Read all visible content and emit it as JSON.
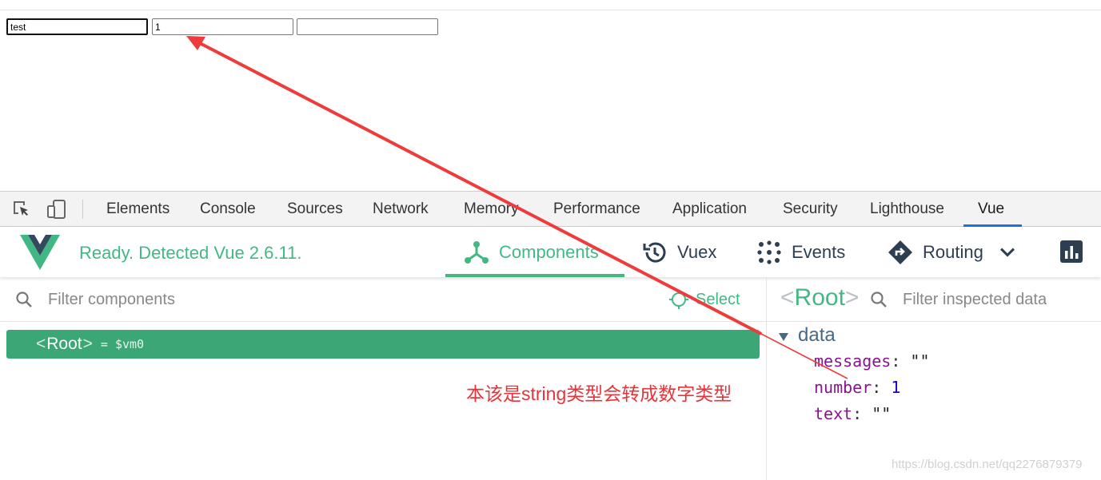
{
  "page": {
    "inputs": [
      {
        "value": "test"
      },
      {
        "value": "1"
      },
      {
        "value": ""
      }
    ]
  },
  "devtools": {
    "tabs": [
      {
        "label": "Elements"
      },
      {
        "label": "Console"
      },
      {
        "label": "Sources"
      },
      {
        "label": "Network"
      },
      {
        "label": "Memory"
      },
      {
        "label": "Performance"
      },
      {
        "label": "Application"
      },
      {
        "label": "Security"
      },
      {
        "label": "Lighthouse"
      },
      {
        "label": "Vue"
      }
    ],
    "active_tab": "Vue",
    "accent": "#1a73e8"
  },
  "vue": {
    "status": "Ready. Detected Vue 2.6.11.",
    "brand_color": "#42b983",
    "nav": [
      {
        "label": "Components",
        "icon": "components-icon"
      },
      {
        "label": "Vuex",
        "icon": "history-icon"
      },
      {
        "label": "Events",
        "icon": "events-icon"
      },
      {
        "label": "Routing",
        "icon": "routing-icon"
      }
    ],
    "filter_placeholder": "Filter components",
    "select_label": "Select",
    "tree": {
      "open": "<",
      "name": "Root",
      "close": ">",
      "vm": "= $vm0"
    },
    "inspector": {
      "open": "<",
      "name": "Root",
      "close": ">",
      "filter_placeholder": "Filter inspected data",
      "section": "data",
      "props": [
        {
          "key": "messages",
          "colon": ":",
          "value": "\"\""
        },
        {
          "key": "number",
          "colon": ":",
          "value": "1"
        },
        {
          "key": "text",
          "colon": ":",
          "value": "\"\""
        }
      ]
    }
  },
  "annotation": {
    "text": "本该是string类型会转成数字类型",
    "color": "#e8333a"
  },
  "watermark": "https://blog.csdn.net/qq2276879379"
}
